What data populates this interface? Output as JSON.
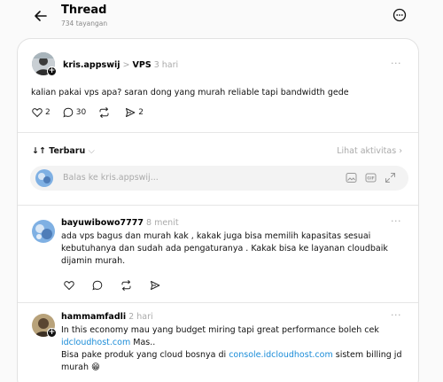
{
  "header": {
    "title": "Thread",
    "views": "734 tayangan"
  },
  "post": {
    "username": "kris.appswij",
    "separator": ">",
    "community": "VPS",
    "time": "3 hari",
    "text": "kalian pakai vps apa? saran dong yang murah reliable tapi bandwidth gede",
    "likes": "2",
    "comments": "30",
    "shares": "2"
  },
  "sort": {
    "label": "Terbaru",
    "activity": "Lihat aktivitas"
  },
  "reply": {
    "placeholder": "Balas ke kris.appswij..."
  },
  "comments": [
    {
      "username": "bayuwibowo7777",
      "time": "8 menit",
      "text": "ada vps bagus dan murah kak , kakak juga bisa memilih kapasitas sesuai kebutuhanya dan sudah ada pengaturanya . Kakak bisa ke layanan cloudbaik dijamin murah."
    },
    {
      "username": "hammamfadli",
      "time": "2 hari",
      "text_1": "In this economy mau yang budget miring tapi great performance boleh cek",
      "link_1": "idcloudhost.com",
      "text_2": "Mas..",
      "text_3": "Bisa pake produk yang cloud bosnya di",
      "link_2": "console.idcloudhost.com",
      "text_4": "sistem billing jd murah 😁"
    }
  ]
}
